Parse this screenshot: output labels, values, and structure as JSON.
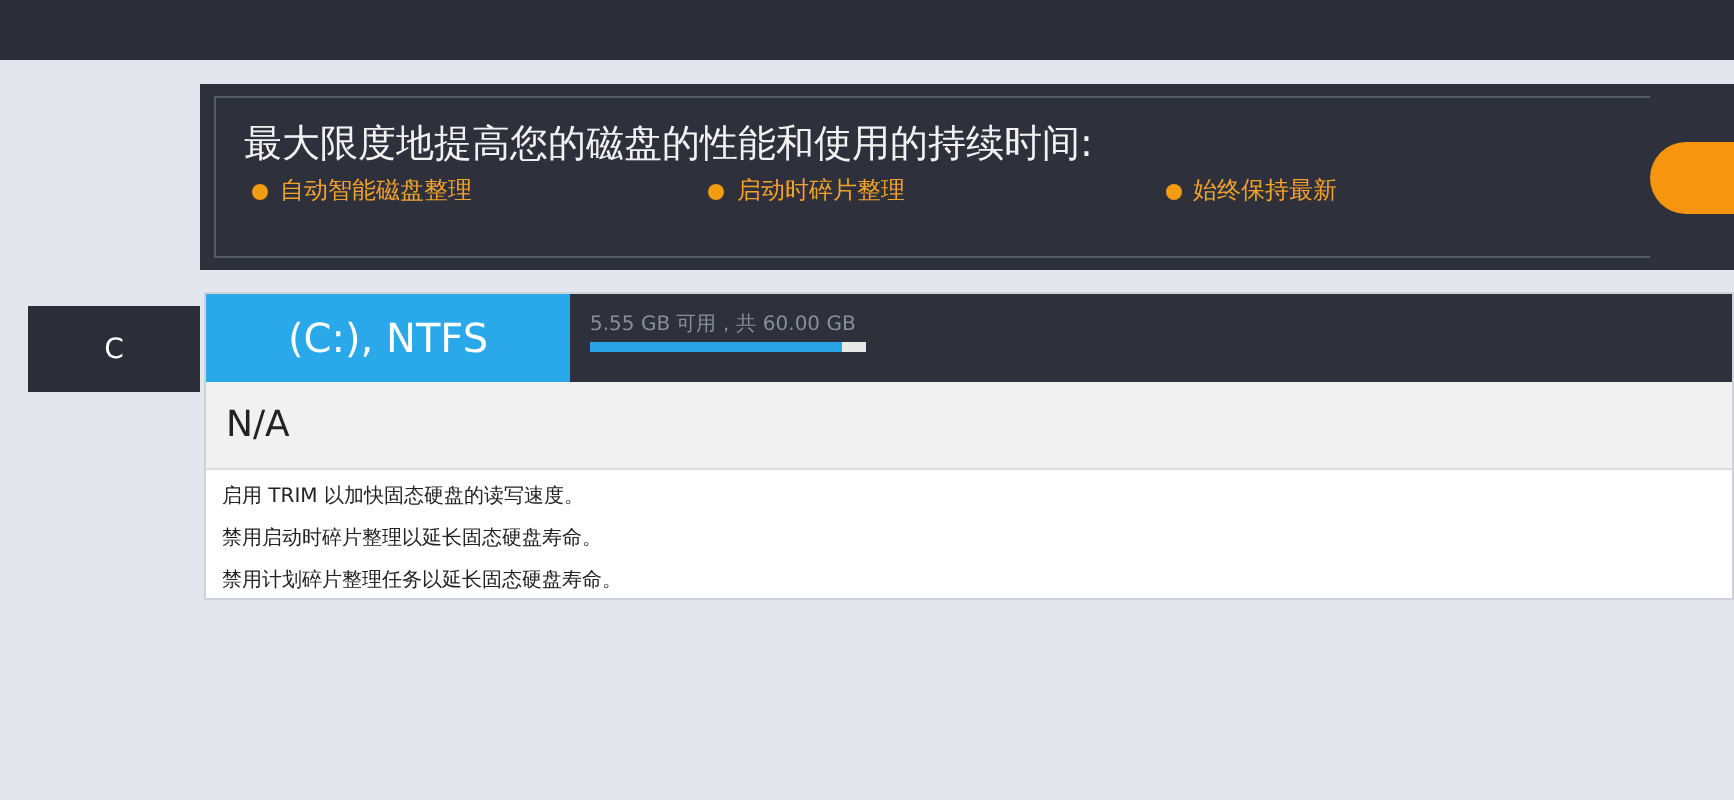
{
  "promo": {
    "title": "最大限度地提高您的磁盘的性能和使用的持续时间:",
    "features": [
      "自动智能磁盘整理",
      "启动时碎片整理",
      "始终保持最新"
    ]
  },
  "drive_tab": {
    "label": "C"
  },
  "drive": {
    "name": "(C:), NTFS",
    "usage": "5.55 GB 可用，共 60.00 GB",
    "level": 0.91,
    "status": "N/A",
    "tips": [
      "启用 TRIM 以加快固态硬盘的读写速度。",
      "禁用启动时碎片整理以延长固态硬盘寿命。",
      "禁用计划碎片整理任务以延长固态硬盘寿命。"
    ]
  }
}
